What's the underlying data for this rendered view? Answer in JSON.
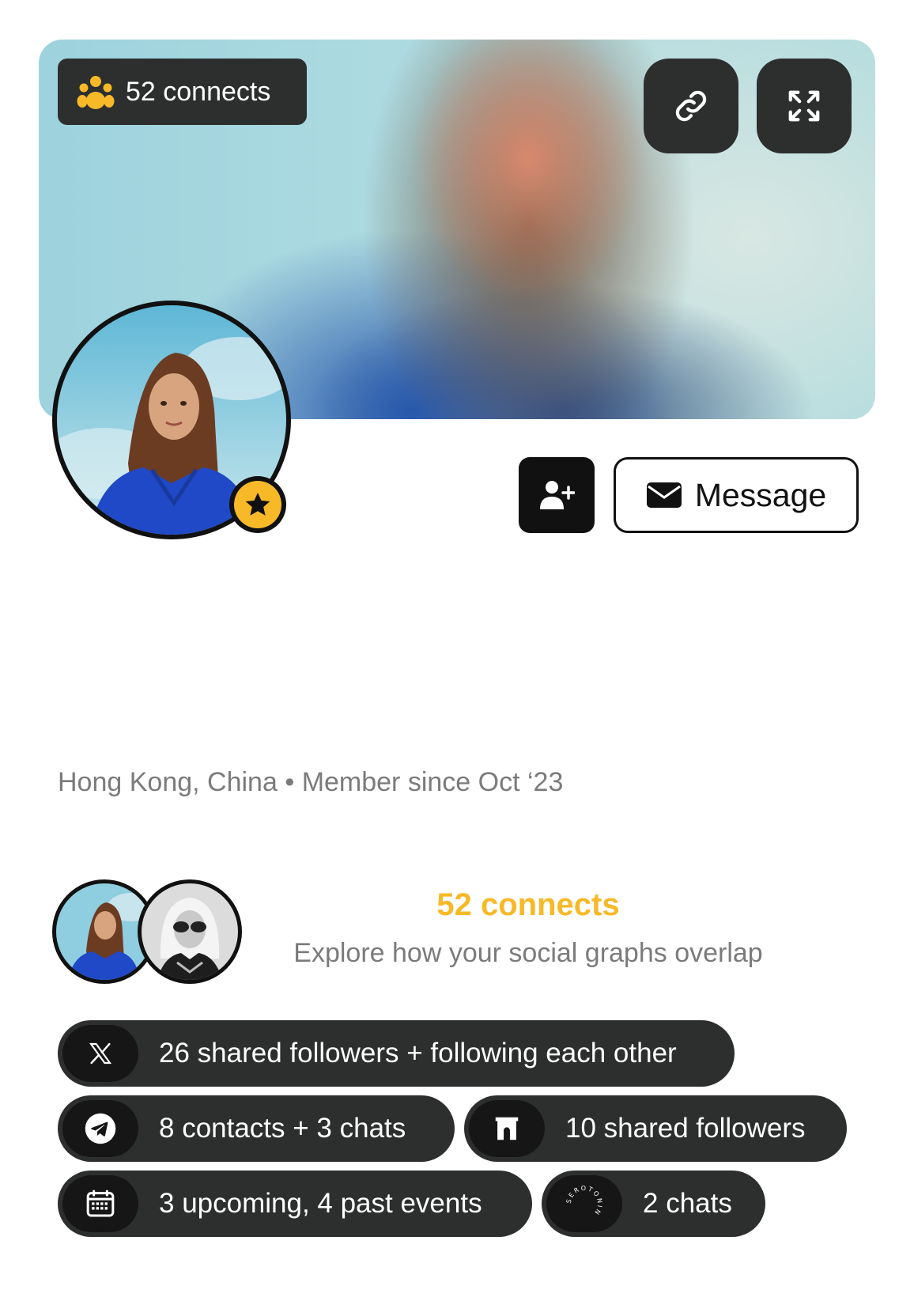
{
  "header": {
    "connects_badge": "52 connects",
    "connects_icon": "people-group-icon",
    "link_icon": "link-icon",
    "expand_icon": "expand-icon"
  },
  "profile": {
    "verified_icon": "star-icon",
    "add_contact_icon": "user-plus-icon",
    "message_label": "Message",
    "message_icon": "envelope-icon",
    "location": "Hong Kong, China",
    "separator": "•",
    "member_since": "Member since Oct ‘23"
  },
  "connections": {
    "title": "52 connects",
    "subtitle": "Explore how your social graphs overlap",
    "chips": [
      {
        "icon": "x-logo-icon",
        "label": "26 shared followers + following each other"
      },
      {
        "icon": "telegram-icon",
        "label": "8 contacts + 3 chats"
      },
      {
        "icon": "farcaster-icon",
        "label": "10 shared followers"
      },
      {
        "icon": "calendar-icon",
        "label": "3 upcoming, 4 past events"
      },
      {
        "icon": "serotonin-logo-icon",
        "label": "2 chats",
        "logo_text": "SEROTONIN"
      }
    ]
  },
  "colors": {
    "accent": "#f7b928",
    "dark_chip": "#2d2f2e",
    "muted_text": "#7b7b7b"
  }
}
